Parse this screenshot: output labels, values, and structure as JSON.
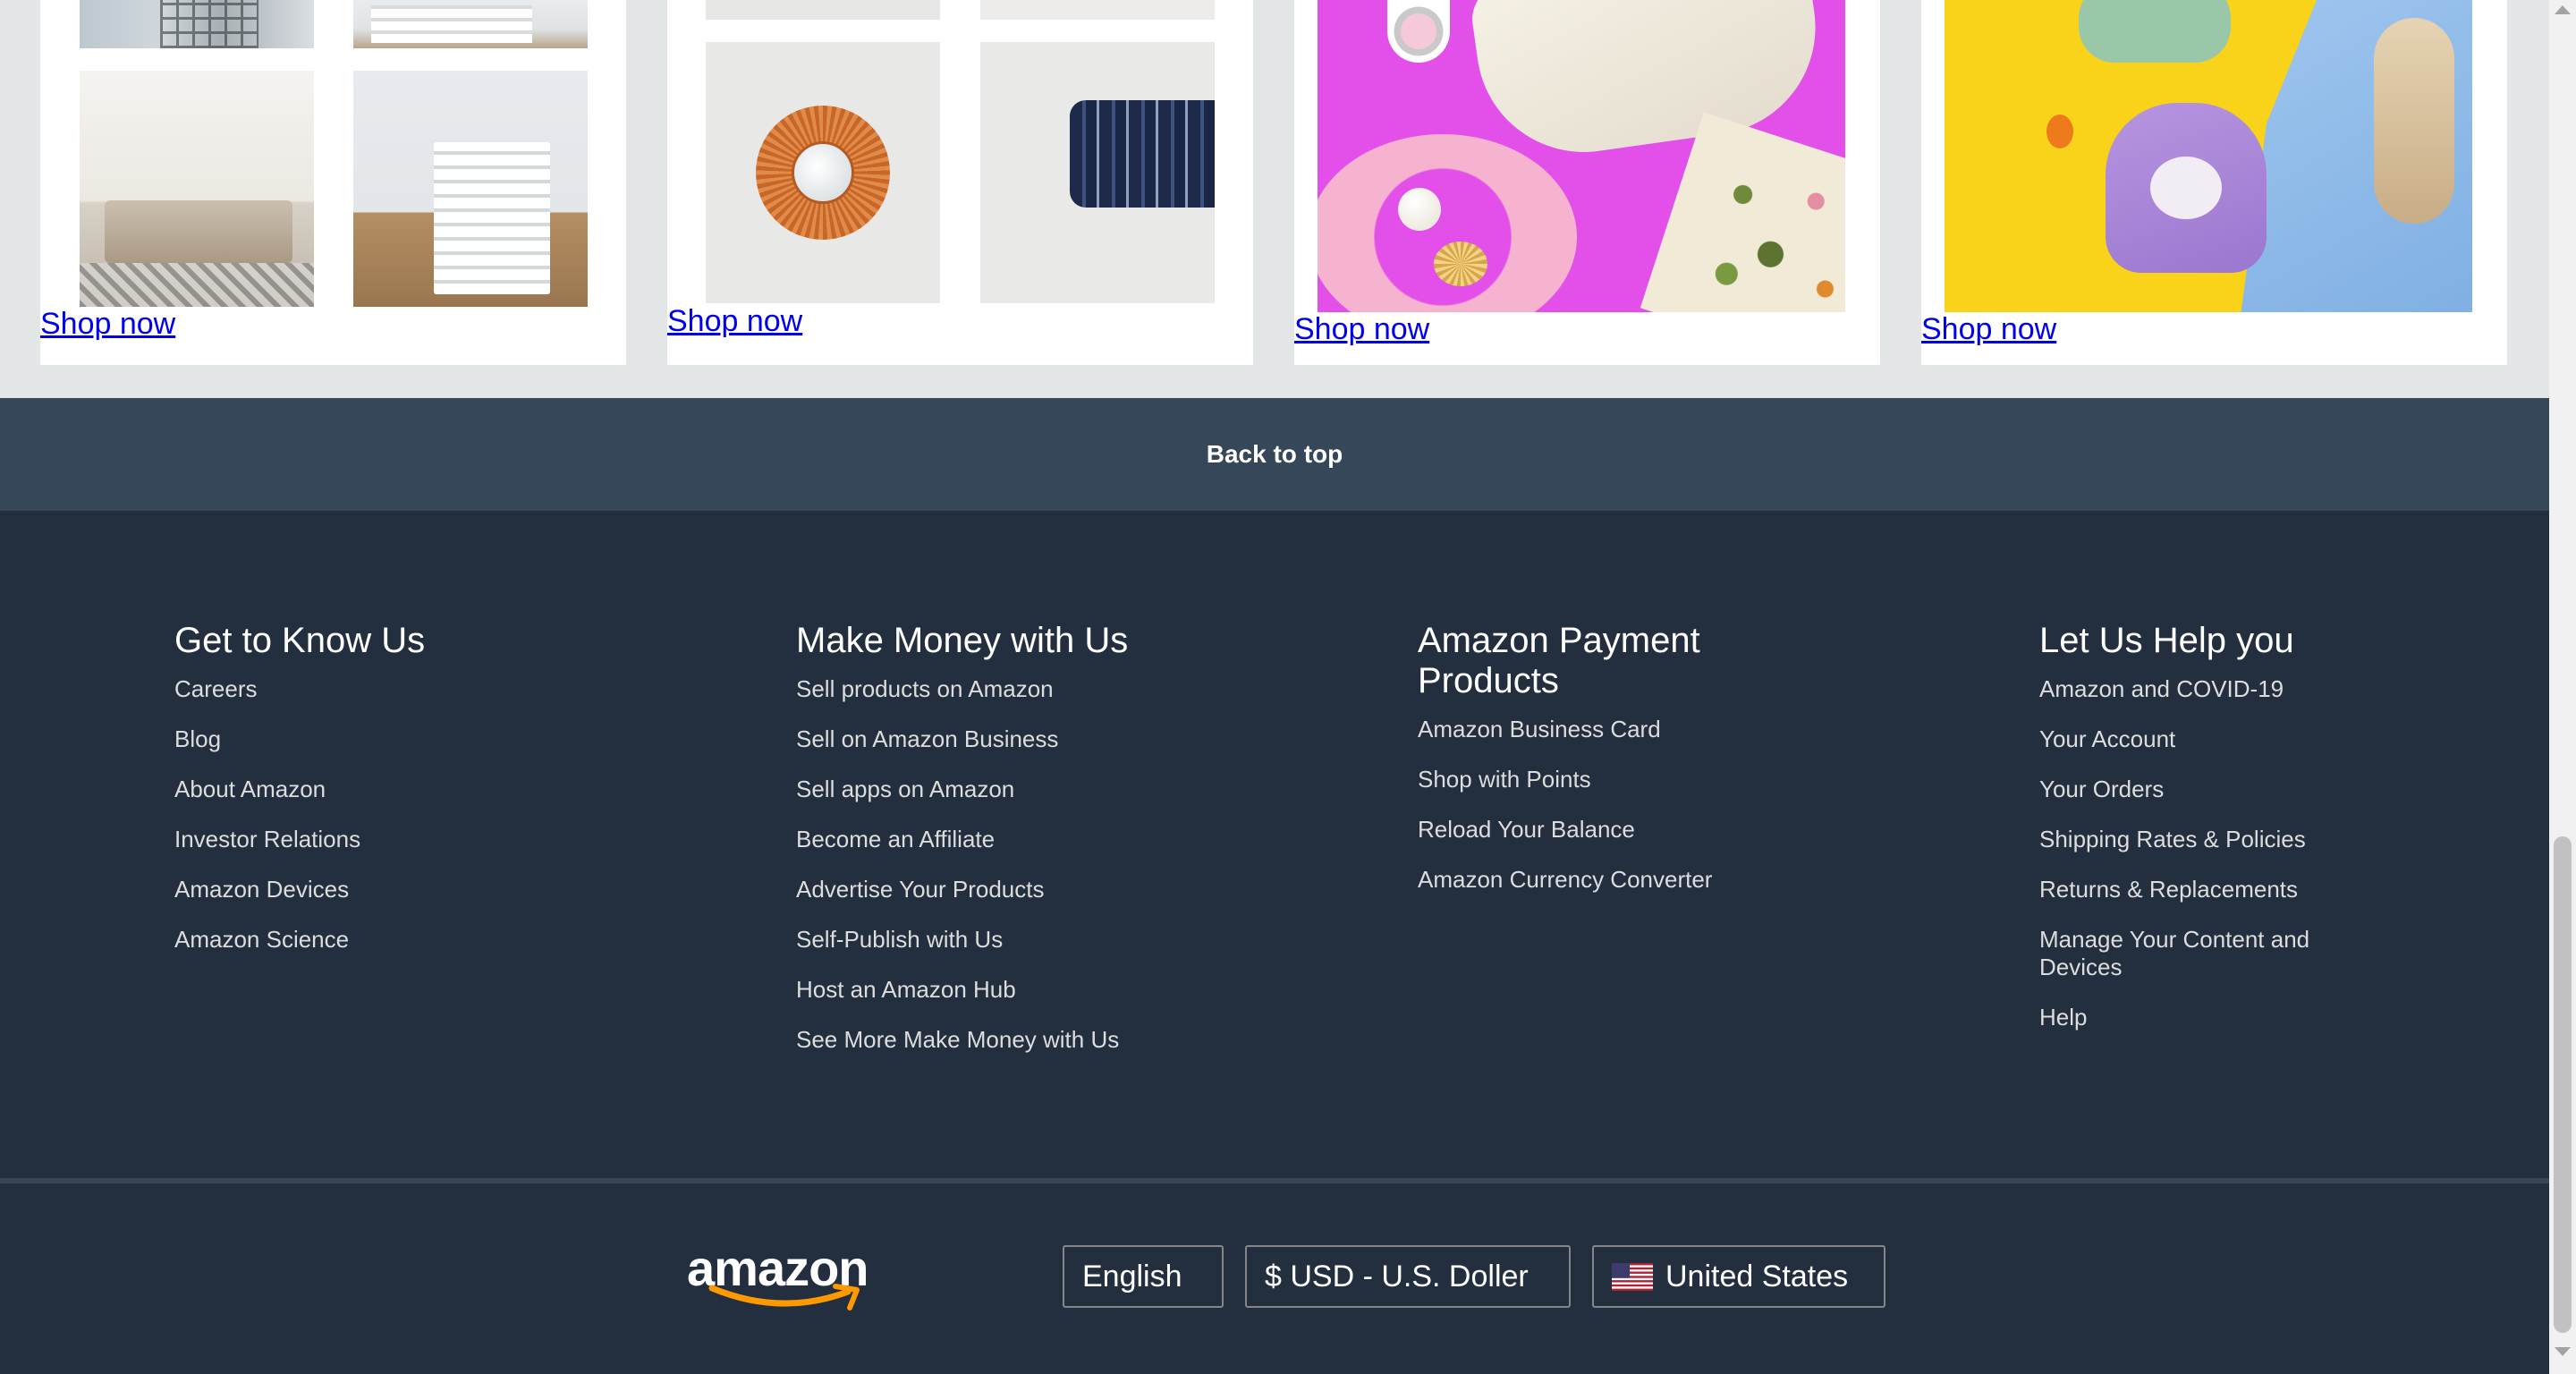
{
  "cards": [
    {
      "link": "Shop now"
    },
    {
      "link": "Shop now"
    },
    {
      "link": "Shop now"
    },
    {
      "link": "Shop now"
    }
  ],
  "back_to_top": "Back to top",
  "footer": {
    "columns": [
      {
        "heading": "Get to Know Us",
        "links": [
          "Careers",
          "Blog",
          "About Amazon",
          "Investor Relations",
          "Amazon Devices",
          "Amazon Science"
        ]
      },
      {
        "heading": "Make Money with Us",
        "links": [
          "Sell products on Amazon",
          "Sell on Amazon Business",
          "Sell apps on Amazon",
          "Become an Affiliate",
          "Advertise Your Products",
          "Self-Publish with Us",
          "Host an Amazon Hub",
          "See More Make Money with Us"
        ]
      },
      {
        "heading": "Amazon Payment Products",
        "links": [
          "Amazon Business Card",
          "Shop with Points",
          "Reload Your Balance",
          "Amazon Currency Converter"
        ]
      },
      {
        "heading": "Let Us Help you",
        "links": [
          "Amazon and COVID-19",
          "Your Account",
          "Your Orders",
          "Shipping Rates & Policies",
          "Returns & Replacements",
          "Manage Your Content and Devices",
          "Help"
        ]
      }
    ],
    "logo": "amazon",
    "language": "English",
    "currency": "$ USD - U.S. Doller",
    "country": "United States",
    "country_flag_icon": "us-flag-icon"
  },
  "colors": {
    "page_bg": "#E3E6E6",
    "back_to_top_bg": "#37475A",
    "footer_bg": "#232F3E",
    "link_blue": "#0000EE",
    "logo_smile": "#FF9900"
  }
}
